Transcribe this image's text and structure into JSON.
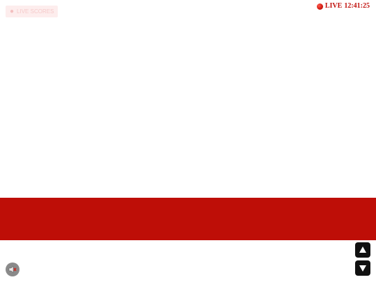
{
  "header": {
    "badge_text": "LIVE SCORES",
    "badge_icon": "person-icon",
    "live_label": "LIVE",
    "live_time": "12:41:25",
    "live_dot_color": "#d41e14"
  },
  "banner": {
    "color": "#be0e07"
  },
  "controls": {
    "scroll_up_icon": "up-arrow-icon",
    "scroll_down_icon": "down-arrow-icon",
    "mute_icon": "speaker-muted-icon"
  }
}
